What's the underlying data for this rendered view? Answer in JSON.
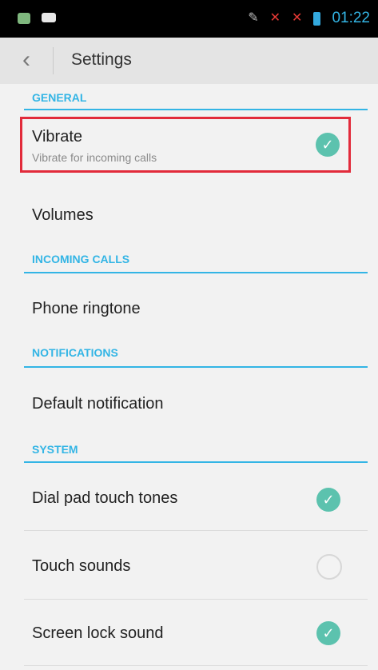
{
  "status": {
    "time": "01:22",
    "left_icons": [
      "signal-app-icon",
      "android-icon"
    ],
    "right_icons": [
      "mute-mic-icon",
      "no-signal-icon-1",
      "no-signal-icon-2",
      "battery-icon"
    ]
  },
  "actionbar": {
    "back_icon": "chevron-left-icon",
    "title": "Settings"
  },
  "sections": [
    {
      "header": "GENERAL"
    },
    {
      "header": "INCOMING CALLS"
    },
    {
      "header": "NOTIFICATIONS"
    },
    {
      "header": "SYSTEM"
    }
  ],
  "items": {
    "vibrate": {
      "title": "Vibrate",
      "subtitle": "Vibrate for incoming calls",
      "checked": true
    },
    "volumes": {
      "title": "Volumes"
    },
    "phone_ringtone": {
      "title": "Phone ringtone"
    },
    "default_notification": {
      "title": "Default notification"
    },
    "dial_pad": {
      "title": "Dial pad touch tones",
      "checked": true
    },
    "touch_sounds": {
      "title": "Touch sounds",
      "checked": false
    },
    "screen_lock": {
      "title": "Screen lock sound",
      "checked": true
    }
  },
  "colors": {
    "accent": "#33b5e5",
    "check": "#5cc2ae",
    "highlight": "#e22b3b"
  }
}
